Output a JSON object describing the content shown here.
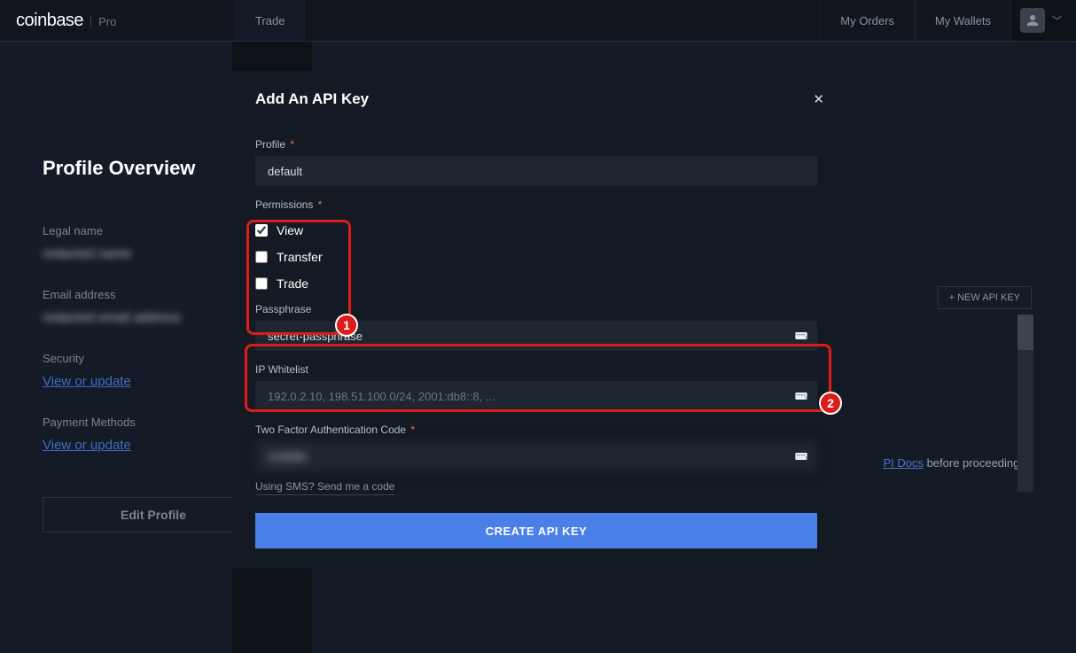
{
  "header": {
    "brand": "coinbase",
    "brand_sub": "Pro",
    "nav": {
      "trade": "Trade",
      "orders": "My Orders",
      "wallets": "My Wallets"
    }
  },
  "profile": {
    "title": "Profile Overview",
    "legal_label": "Legal name",
    "legal_value": "redacted name",
    "email_label": "Email address",
    "email_value": "redacted email address",
    "security_label": "Security",
    "security_link": "View or update",
    "payment_label": "Payment Methods",
    "payment_link": "View or update",
    "edit_button": "Edit Profile"
  },
  "right": {
    "new_key": "+ NEW API KEY",
    "docs_prefix": "PI Docs",
    "docs_suffix": " before proceeding."
  },
  "modal": {
    "title": "Add An API Key",
    "profile_label": "Profile",
    "profile_value": "default",
    "perm_label": "Permissions",
    "perm_view": "View",
    "perm_transfer": "Transfer",
    "perm_trade": "Trade",
    "pass_label": "Passphrase",
    "pass_value": "secret-passphrase",
    "ip_label": "IP Whitelist",
    "ip_placeholder": "192.0.2.10, 198.51.100.0/24, 2001:db8::8, ...",
    "tfa_label": "Two Factor Authentication Code",
    "tfa_value": "123456",
    "sms_link": "Using SMS? Send me a code",
    "create": "CREATE API KEY"
  },
  "annotations": {
    "1": "1",
    "2": "2"
  }
}
